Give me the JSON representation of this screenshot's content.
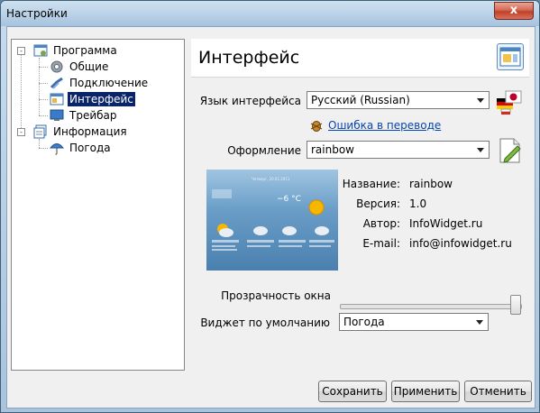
{
  "window": {
    "title": "Настройки",
    "close_label": "x"
  },
  "tree": {
    "items": [
      {
        "label": "Программа",
        "toggle": "-"
      },
      {
        "label": "Общие"
      },
      {
        "label": "Подключение"
      },
      {
        "label": "Интерфейс"
      },
      {
        "label": "Трейбар"
      },
      {
        "label": "Информация",
        "toggle": "-"
      },
      {
        "label": "Погода"
      }
    ]
  },
  "panel": {
    "title": "Интерфейс",
    "language": {
      "label": "Язык интерфейса",
      "value": "Русский (Russian)"
    },
    "translation_error_link": "Ошибка в переводе",
    "theme": {
      "label": "Оформление",
      "value": "rainbow"
    },
    "preview": {
      "temp": "−6 °C",
      "date": "Четверг, 20.01.2011"
    },
    "info": [
      {
        "key": "Название:",
        "value": "rainbow"
      },
      {
        "key": "Версия:",
        "value": "1.0"
      },
      {
        "key": "Автор:",
        "value": "InfoWidget.ru"
      },
      {
        "key": "E-mail:",
        "value": "info@infowidget.ru"
      }
    ],
    "transparency": {
      "label": "Прозрачность окна",
      "value_fraction": 0.96
    },
    "default_widget": {
      "label": "Виджет по умолчанию",
      "value": "Погода"
    }
  },
  "buttons": {
    "save": "Сохранить",
    "apply": "Применить",
    "cancel": "Отменить"
  },
  "colors": {
    "selection": "#0a246a",
    "link": "#0645ad",
    "close": "#c0402a"
  }
}
